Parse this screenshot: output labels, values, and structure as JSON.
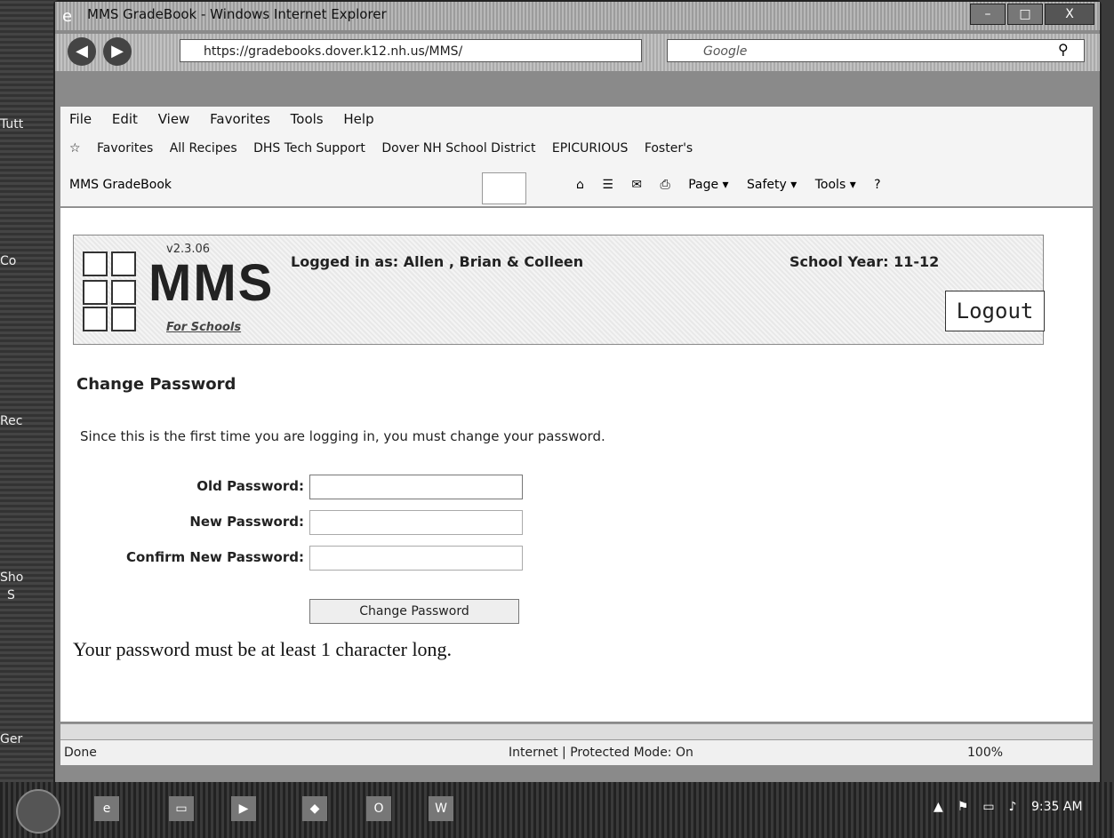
{
  "desktop": {
    "labels": [
      "Tutt",
      "Co",
      "Rec",
      "Sho",
      "S",
      "Ger"
    ]
  },
  "window": {
    "title": "MMS GradeBook - Windows Internet Explorer",
    "address": "https://gradebooks.dover.k12.nh.us/MMS/",
    "search_placeholder": "Google",
    "controls": {
      "minimize": "–",
      "maximize": "□",
      "close": "X"
    }
  },
  "menubar": {
    "items": [
      "File",
      "Edit",
      "View",
      "Favorites",
      "Tools",
      "Help"
    ]
  },
  "favorites": {
    "label": "Favorites",
    "items": [
      "All Recipes",
      "DHS Tech Support",
      "Dover NH School District",
      "EPICURIOUS",
      "Foster's"
    ]
  },
  "tab": {
    "title": "MMS GradeBook"
  },
  "commandbar": {
    "items": [
      "Page ▾",
      "Safety ▾",
      "Tools ▾"
    ]
  },
  "header": {
    "version": "v2.3.06",
    "logo_main": "MMS",
    "logo_sub": "For Schools",
    "logged_in": "Logged in as: Allen , Brian & Colleen",
    "school_year": "School Year: 11-12",
    "logout": "Logout"
  },
  "page": {
    "title": "Change Password",
    "intro": "Since this is the first time you are logging in, you must change your password.",
    "fields": {
      "old": {
        "label": "Old Password:",
        "value": ""
      },
      "new": {
        "label": "New Password:",
        "value": ""
      },
      "confirm": {
        "label": "Confirm New Password:",
        "value": ""
      }
    },
    "submit": "Change Password",
    "note": "Your password must be at least 1 character long."
  },
  "status": {
    "text": "Done",
    "zone": "Internet | Protected Mode: On",
    "zoom": "100%"
  },
  "taskbar": {
    "clock": "9:35 AM"
  }
}
